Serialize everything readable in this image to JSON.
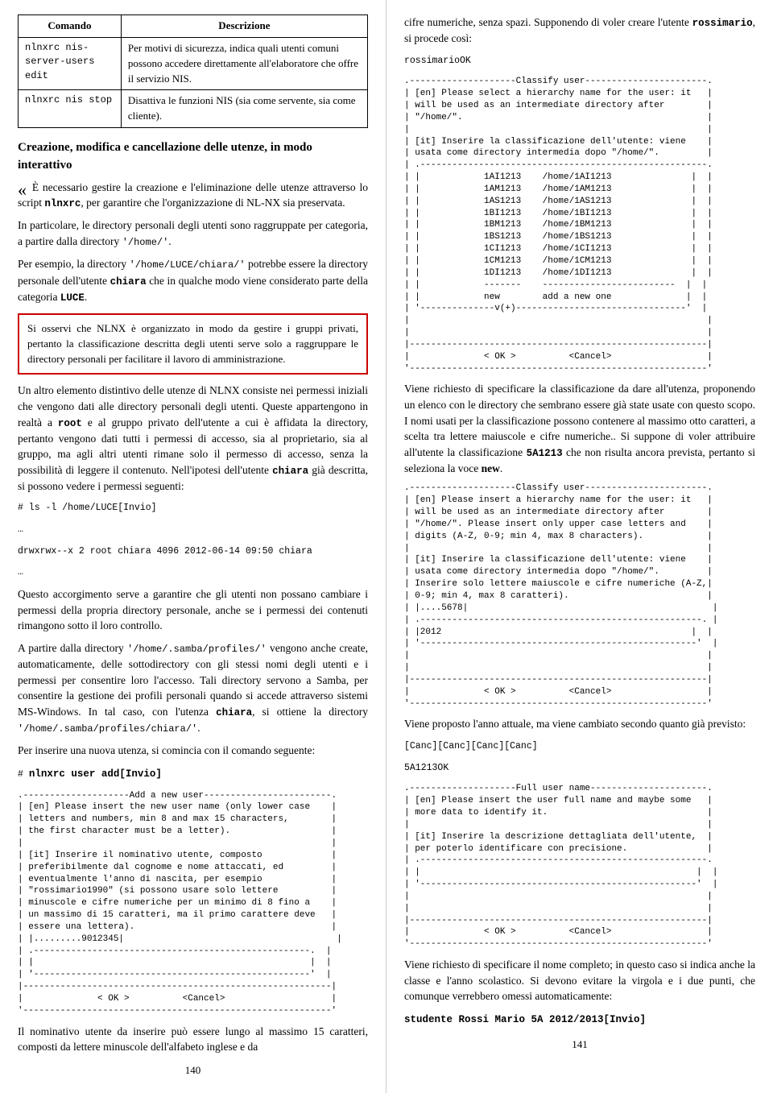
{
  "left": {
    "table": {
      "headers": [
        "Comando",
        "Descrizione"
      ],
      "rows": [
        {
          "cmd": "nlnxrc nis-server-users edit",
          "desc": "Per motivi di sicurezza, indica quali utenti comuni possono accedere direttamente all'elaboratore che offre il servizio NIS."
        },
        {
          "cmd": "nlnxrc nis stop",
          "desc": "Disattiva le funzioni NIS (sia come servente, sia come cliente)."
        }
      ]
    },
    "section_title": "Creazione, modifica e cancellazione delle utenze, in modo interattivo",
    "para1": "È necessario gestire la creazione e l'eliminazione delle utenze attraverso lo script ",
    "para1_cmd": "nlnxrc",
    "para1_rest": ", per garantire che l'organizzazione di NL-NX sia preservata.",
    "para2": "In particolare, le directory personali degli utenti sono raggruppate per categoria, a partire dalla directory ",
    "para2_code": "'/home/'",
    "para2_rest": ".",
    "para3": "Per esempio, la directory ",
    "para3_code1": "'/home/LUCE/chiara/'",
    "para3_mid": " potrebbe essere la directory personale dell'utente ",
    "para3_code2": "chiara",
    "para3_rest": " che in qualche modo viene considerato parte della categoria ",
    "para3_code3": "LUCE",
    "para3_end": ".",
    "highlighted": "Si osservi che NLNX è organizzato in modo da gestire i gruppi privati, pertanto la classificazione descritta degli utenti serve solo a raggruppare le directory personali per facilitare il lavoro di amministrazione.",
    "para4": "Un altro elemento distintivo delle utenze di NLNX consiste nei permessi iniziali che vengono dati alle directory personali degli utenti. Queste appartengono in realtà a ",
    "para4_code1": "root",
    "para4_mid1": " e al gruppo privato dell'utente a cui è affidata la directory, pertanto vengono dati tutti i permessi di accesso, sia al proprietario, sia al gruppo, ma agli altri utenti rimane solo il permesso di accesso, senza la possibilità di leggere il contenuto. Nell'ipotesi dell'utente ",
    "para4_code2": "chiara",
    "para4_rest": " già descritta, si possono vedere i permessi seguenti:",
    "cmd_ls": "# ls -l /home/LUCE[Invio]",
    "ellipsis1": "…",
    "cmd_ls_result": "drwxrwx--x  2 root    chiara    4096 2012-06-14 09:50 chiara",
    "ellipsis2": "…",
    "para5": "Questo accorgimento serve a garantire che gli utenti non possano cambiare i permessi della propria directory personale, anche se i permessi dei contenuti rimangono sotto il loro controllo.",
    "para6": "A partire dalla directory ",
    "para6_code": "'/home/.samba/profiles/'",
    "para6_rest1": " vengono anche create, automaticamente, delle sottodirectory con gli stessi nomi degli utenti e i permessi per consentire loro l'accesso. Tali directory servono a Samba, per consentire la gestione dei profili personali quando si accede attraverso sistemi MS-Windows. In tal caso, con l'utenza ",
    "para6_code2": "chiara",
    "para6_rest2": ", si ottiene la directory ",
    "para6_code3": "'/home/.samba/profiles/chiara/'",
    "para6_end": ".",
    "para7": "Per inserire una nuova utenza, si comincia con il comando seguente:",
    "cmd_add": "# nlnxrc user add[Invio]",
    "terminal_add": ".--------------------Add a new user------------------------.\n| [en] Please insert the new user name (only lower case    |\n| letters and numbers, min 8 and max 15 characters,        |\n| the first character must be a letter).                   |\n|                                                          |\n| [it] Inserire il nominativo utente, composto             |\n| preferibilmente dal cognome e nome attaccati, ed         |\n| eventualmente l'anno di nascita, per esempio             |\n| \"rossimario1990\" (si possono usare solo lettere          |\n| minuscole e cifre numeriche per un minimo di 8 fino a    |\n| un massimo di 15 caratteri, ma il primo carattere deve   |\n| essere una lettera).                                     |\n| |.........9012345|                                        |\n| .----------------------------------------------------.  |\n| |                                                    |  |\n| '----------------------------------------------------'  |\n|----------------------------------------------------------|\n|              < OK >          <Cancel>                    |\n'----------------------------------------------------------'",
    "para8": "Il nominativo utente da inserire può essere lungo al massimo 15 caratteri, composti da lettere minuscole dell'alfabeto inglese e da",
    "page_num_left": "140"
  },
  "right": {
    "para_intro": "cifre numeriche, senza spazi. Supponendo di voler creare l'utente ",
    "para_intro_user": "rossimario",
    "para_intro_rest": ", si procede così:",
    "cmd_rossimario": "rossimario",
    "cmd_ok": "OK",
    "terminal_classify1": ".--------------------Classify user-----------------------.\n| [en] Please select a hierarchy name for the user: it   |\n| will be used as an intermediate directory after        |\n| \"/home/\".                                              |\n|                                                        |\n| [it] Inserire la classificazione dell'utente: viene    |\n| usata come directory intermedia dopo \"/home/\".         |\n| .------------------------------------------------------.\n| |            1AI1213    /home/1AI1213               |  |\n| |            1AM1213    /home/1AM1213               |  |\n| |            1AS1213    /home/1AS1213               |  |\n| |            1BI1213    /home/1BI1213               |  |\n| |            1BM1213    /home/1BM1213               |  |\n| |            1BS1213    /home/1BS1213               |  |\n| |            1CI1213    /home/1CI1213               |  |\n| |            1CM1213    /home/1CM1213               |  |\n| |            1DI1213    /home/1DI1213               |  |\n| |            -------    -------------------------  |  |\n| |            new        add a new one              |  |\n| '--------------v(+)--------------------------------'  |\n|                                                        |\n|                                                        |\n|--------------------------------------------------------|\n|              < OK >          <Cancel>                  |\n'--------------------------------------------------------'",
    "para_classify1": "Viene richiesto di specificare la classificazione da dare all'utenza, proponendo un elenco con le directory che sembrano essere già state usate con questo scopo. I nomi usati per la classificazione possono contenere al massimo otto caratteri, a scelta tra lettere maiuscole e cifre numeriche.. Si suppone di voler attribuire all'utente la classificazione ",
    "classif_code": "5A1213",
    "para_classify1_rest": " che non risulta ancora prevista, pertanto si seleziona la voce ",
    "new_word": "new",
    "para_classify1_end": ".",
    "terminal_classify2": ".--------------------Classify user-----------------------.\n| [en] Please insert a hierarchy name for the user: it   |\n| will be used as an intermediate directory after        |\n| \"/home/\". Please insert only upper case letters and    |\n| digits (A-Z, 0-9; min 4, max 8 characters).            |\n|                                                        |\n| [it] Inserire la classificazione dell'utente: viene    |\n| usata come directory intermedia dopo \"/home/\".         |\n| Inserire solo lettere maiuscole e cifre numeriche (A-Z,|\n| 0-9; min 4, max 8 caratteri).                          |\n| |....5678|                                              |\n| .-----------------------------------------------------. |\n| |2012                                               |  |\n| '----------------------------------------------------'  |\n|                                                        |\n|                                                        |\n|--------------------------------------------------------|\n|              < OK >          <Cancel>                  |\n'--------------------------------------------------------'",
    "para_proposed": "Viene proposto l'anno attuale, ma viene cambiato secondo quanto già previsto:",
    "canc_row": "[Canc][Canc][Canc][Canc]",
    "code_5A1213": "5A1213",
    "ok2": "OK",
    "terminal_fullname": ".--------------------Full user name----------------------.\n| [en] Please insert the user full name and maybe some   |\n| more data to identify it.                              |\n|                                                        |\n| [it] Inserire la descrizione dettagliata dell'utente,  |\n| per poterlo identificare con precisione.               |\n| .------------------------------------------------------.\n| |                                                    |  |\n| '----------------------------------------------------'  |\n|                                                        |\n|                                                        |\n|--------------------------------------------------------|\n|              < OK >          <Cancel>                  |\n'--------------------------------------------------------'",
    "para_fullname": "Viene richiesto di specificare il nome completo; in questo caso si indica anche la classe e l'anno scolastico. Si devono evitare la virgola e i due punti, che comunque verrebbero omessi automaticamente:",
    "cmd_studente": "studente Rossi Mario 5A 2012/2013[Invio]",
    "page_num_right": "141"
  }
}
